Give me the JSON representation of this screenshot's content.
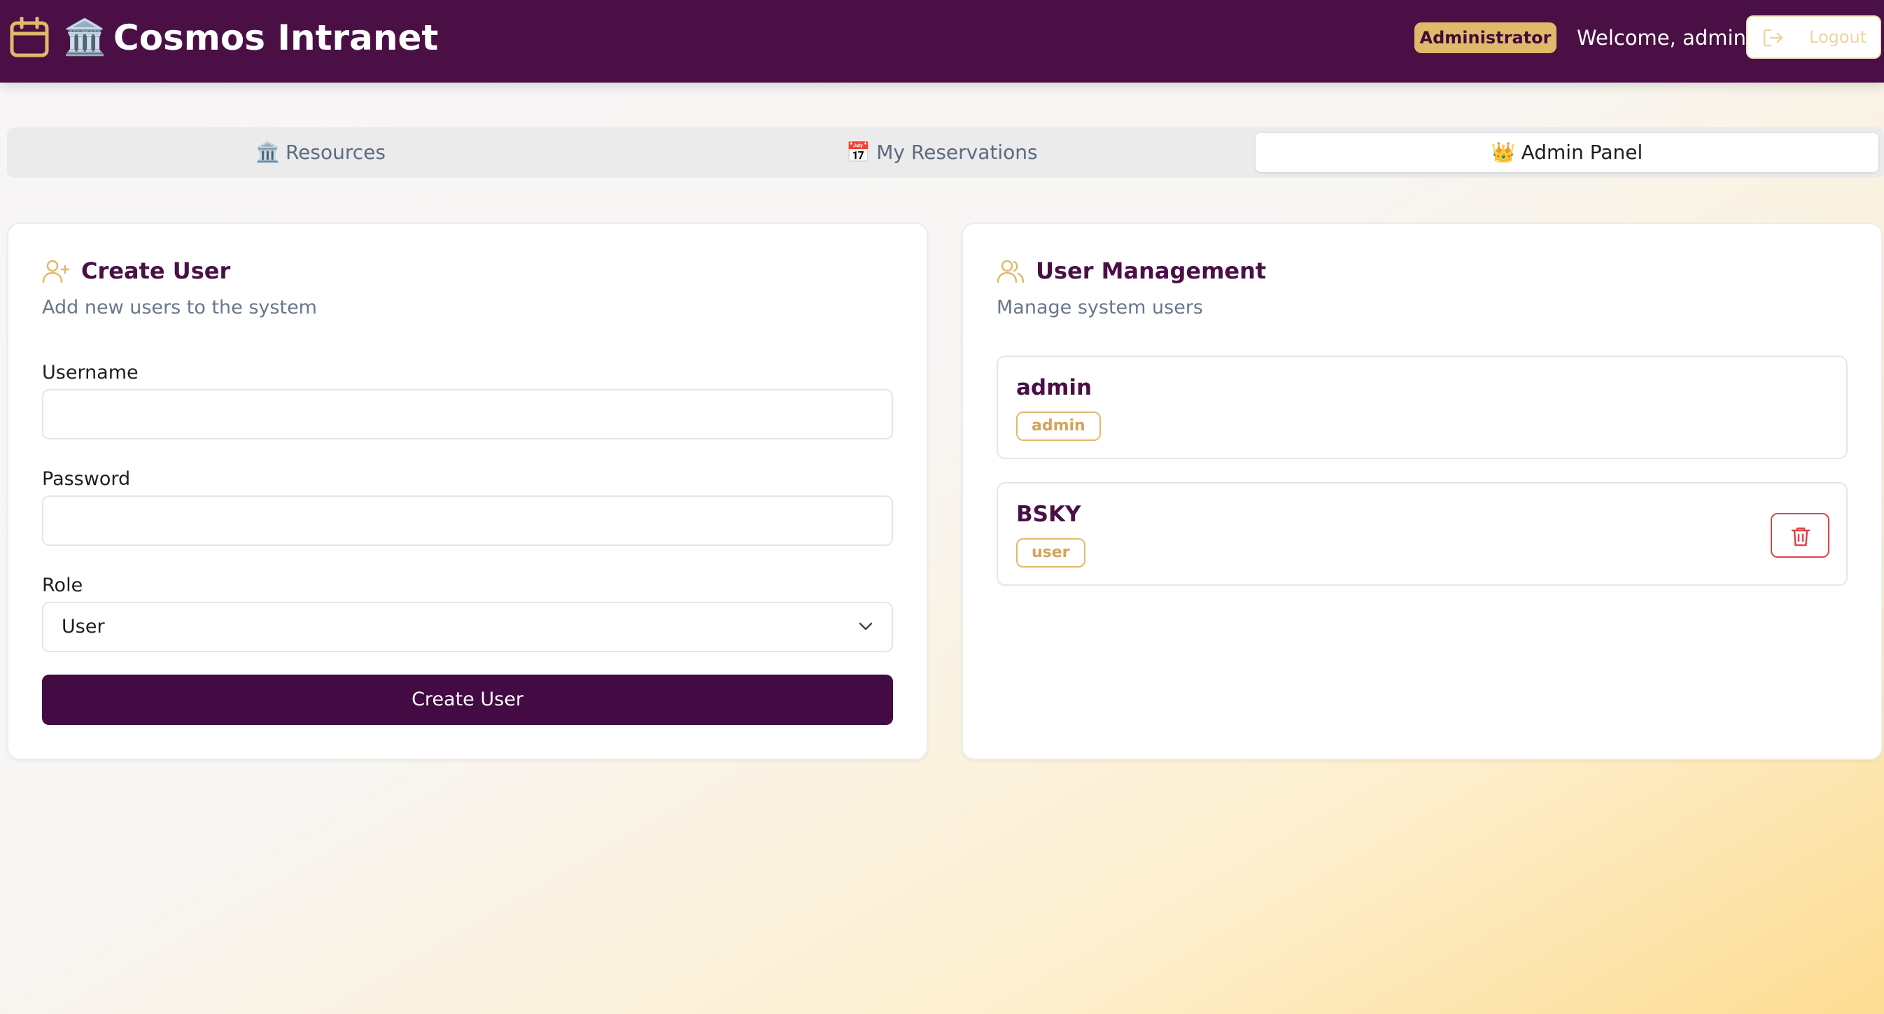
{
  "header": {
    "app_title": "Cosmos Intranet",
    "brand_icon": "calendar-icon",
    "brand_emoji": "🏛️",
    "role_badge": "Administrator",
    "welcome": "Welcome, admin",
    "logout_label": "Logout"
  },
  "tabs": [
    {
      "emoji": "🏛️",
      "label": "Resources",
      "active": false
    },
    {
      "emoji": "📅",
      "label": "My Reservations",
      "active": false
    },
    {
      "emoji": "👑",
      "label": "Admin Panel",
      "active": true
    }
  ],
  "create_user": {
    "title": "Create User",
    "subtitle": "Add new users to the system",
    "username_label": "Username",
    "username_value": "",
    "password_label": "Password",
    "password_value": "",
    "role_label": "Role",
    "role_value": "User",
    "submit_label": "Create User"
  },
  "user_management": {
    "title": "User Management",
    "subtitle": "Manage system users",
    "users": [
      {
        "name": "admin",
        "role": "admin",
        "deletable": false
      },
      {
        "name": "BSKY",
        "role": "user",
        "deletable": true
      }
    ]
  },
  "colors": {
    "header_bg": "#4a1046",
    "accent_gold": "#e2b86a",
    "primary_button": "#430a44",
    "danger": "#e0424a"
  }
}
